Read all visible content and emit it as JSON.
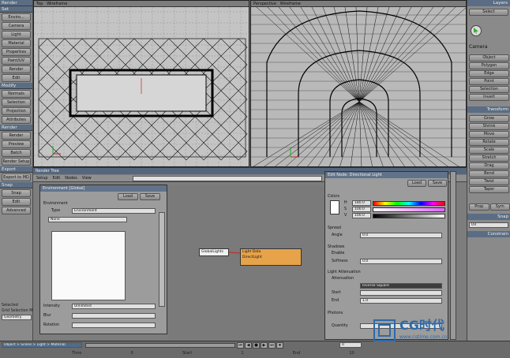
{
  "left_panel": {
    "render_header": "Render",
    "sections": [
      {
        "title": "Set",
        "buttons": [
          "Enviro...",
          "Camera",
          "Light",
          "Material",
          "Properties",
          "Paint/UV",
          "Render",
          "Edit"
        ]
      },
      {
        "title": "Modify",
        "buttons": [
          "Normals",
          "Selection",
          "Projection",
          "Attributes"
        ]
      },
      {
        "title": "Render",
        "buttons": [
          "Render",
          "Preview",
          "Batch",
          "Render Setup"
        ]
      },
      {
        "title": "Export",
        "buttons": [
          "Export to MD"
        ]
      },
      {
        "title": "Snap",
        "buttons": [
          "Snap",
          "Edit",
          "Advanced"
        ]
      }
    ],
    "bottom_label": "Selected",
    "bottom_label2": "Grid Selection Mode",
    "bottom_field": "Geometry"
  },
  "viewport_top": {
    "label": "Top",
    "mode": "Wireframe"
  },
  "viewport_persp": {
    "label": "Perspective",
    "mode": "Wireframe"
  },
  "right_panel": {
    "sections": [
      "Layers",
      "Select",
      "Transform",
      "Snap",
      "Constrain"
    ],
    "buttons": [
      "Object",
      "Polygon",
      "Edge",
      "Point",
      "Selection",
      "Invert",
      "Grow",
      "Shrink",
      "Move",
      "Rotate",
      "Scale",
      "Stretch",
      "Drag",
      "Bend",
      "Twist",
      "Taper"
    ],
    "select_label": "Select",
    "camera_btn": "Camera",
    "view_btns": [
      "Prop",
      "Sym"
    ],
    "uv_label": "UV"
  },
  "node_editor": {
    "title": "Nodes",
    "tree_label": "Render Tree",
    "toolbar": [
      "Setup",
      "Edit",
      "Nodes",
      "View"
    ],
    "search_placeholder": "Search",
    "nodes": [
      {
        "label": "GlobalLights",
        "title": "Global Illum"
      },
      {
        "label": "DirectLight",
        "title": "Light Data"
      },
      {
        "label": "Light Color",
        "title": ""
      }
    ]
  },
  "env_panel": {
    "title": "Environment [Global]",
    "load": "Load",
    "save": "Save",
    "section": "Environment",
    "type_label": "Type",
    "type_value": "Environment",
    "image_label": "Image",
    "image_value": "None",
    "field1_label": "Intensity",
    "field1_value": "Unlimited",
    "field2_label": "Blur",
    "field3_label": "Rotation"
  },
  "light_panel": {
    "title": "Edit Node: Directional Light",
    "load": "Load",
    "save": "Save",
    "sections": [
      "Colors",
      "Spread",
      "Shadows",
      "Light Attenuation",
      "Photons"
    ],
    "color_rows": [
      "H",
      "S",
      "V"
    ],
    "color_values": [
      "180.0",
      "100.0",
      "100.0"
    ],
    "spread_label": "Angle",
    "spread_value": "0.0",
    "shadow_label1": "Enable",
    "shadow_label2": "Softness",
    "shadow_value": "0.0",
    "atten_label": "Attenuation",
    "atten_type": "Inverse Square",
    "atten_field1": "Start",
    "atten_field2": "End",
    "atten_value": "1.0",
    "photon_label": "Photons",
    "photon_field": "Quantity"
  },
  "timeline": {
    "path": "Object > Scene > Light > Material",
    "frame": "0",
    "fields": [
      "Time",
      "Start",
      "End"
    ],
    "frame_values": [
      "0",
      "1",
      "10"
    ]
  },
  "watermark": {
    "brand": "CG时代",
    "url": "www.cgtime.com.cn"
  }
}
